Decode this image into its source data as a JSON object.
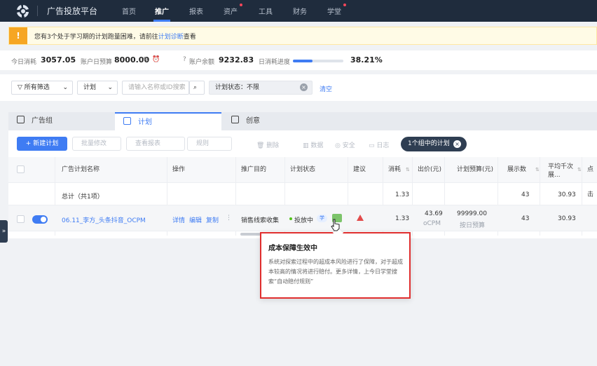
{
  "topbar": {
    "brand": "广告投放平台",
    "nav": [
      "首页",
      "推广",
      "报表",
      "资产",
      "工具",
      "财务",
      "学堂"
    ],
    "active": "推广"
  },
  "notice": {
    "icon": "!",
    "text_before": "您有3个处于学习期的计划跑量困难，请前往",
    "link": "计划诊断",
    "text_after": "查看"
  },
  "stats": {
    "today_cost_label": "今日消耗",
    "today_cost": "3057.05",
    "daily_budget_label": "账户日预算",
    "daily_budget": "8000.00",
    "balance_label": "账户余额",
    "balance": "9232.83",
    "progress_label": "日消耗进度",
    "progress_pct": "38.21%",
    "progress_fraction": 0.3821
  },
  "filters": {
    "all_filters": "所有筛选",
    "scope": "计划",
    "search_placeholder": "请输入名称或ID搜索",
    "status": "计划状态：不限",
    "clear": "清空"
  },
  "tabs": [
    "广告组",
    "计划",
    "创意"
  ],
  "toolbar": {
    "new_plan": "+ 新建计划",
    "batch_edit": "批量修改",
    "view_report": "查看报表",
    "rules": "规则",
    "delete": "删除",
    "data": "数据",
    "security": "安全",
    "diag": "日志",
    "selection": "1个组中的计划"
  },
  "table": {
    "headers": [
      "广告计划名称",
      "操作",
      "推广目的",
      "计划状态",
      "建议",
      "消耗",
      "出价(元)",
      "计划预算(元)",
      "展示数",
      "平均千次展...",
      "点击"
    ],
    "total": {
      "label": "总计（共1项）",
      "cost": "1.33",
      "impressions": "43",
      "cpm": "30.93"
    },
    "row": {
      "name": "06.11_李方_头条抖音_OCPM",
      "actions": [
        "详情",
        "编辑",
        "复制"
      ],
      "more": "⋮",
      "purpose": "销售线索收集",
      "status": "投放中",
      "status_tag": "学",
      "cost": "1.33",
      "bid": "43.69",
      "bid_type": "oCPM",
      "budget": "99999.00",
      "budget_type": "按日预算",
      "impressions": "43",
      "cpm": "30.93"
    }
  },
  "tooltip": {
    "title": "成本保障生效中",
    "body": "系统对探索过程中的超成本风险进行了保障，对于超成本较高的情况将进行赔付。更多详情，上今日学堂搜索“自动赔付规则”"
  },
  "colors": {
    "topbar": "#1f2c3d",
    "accent": "#3f7cf3",
    "highlight_border": "#e02e2e",
    "warning": "#f6a623"
  }
}
